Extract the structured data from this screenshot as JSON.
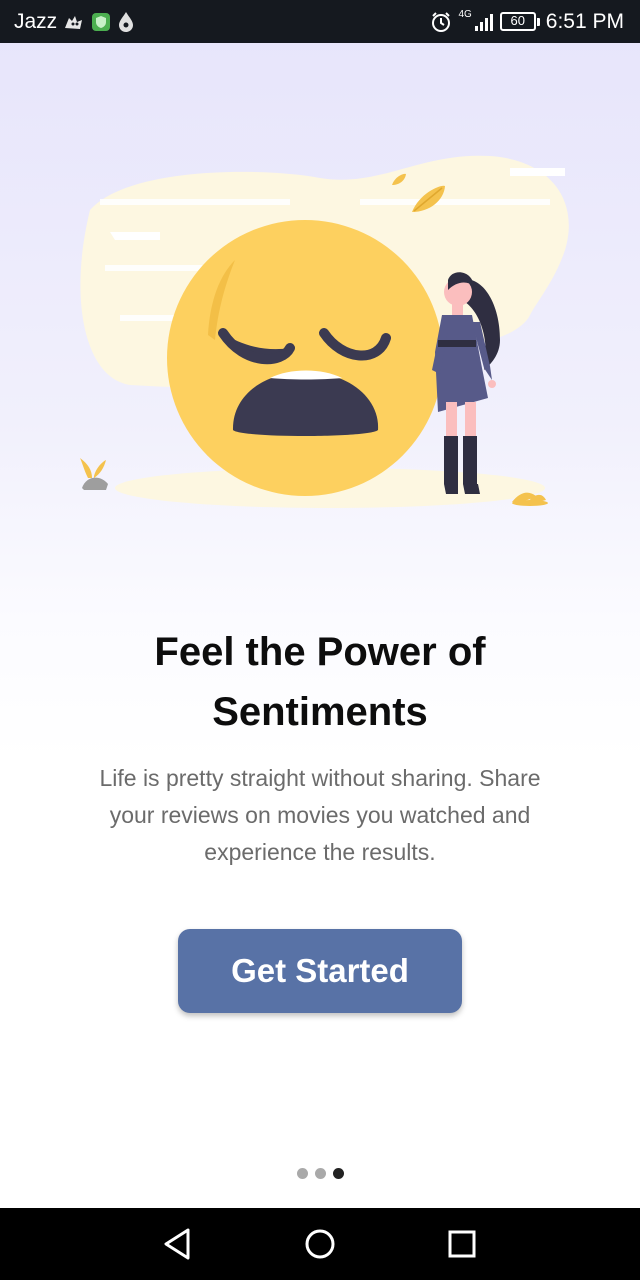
{
  "status_bar": {
    "carrier": "Jazz",
    "network": "4G",
    "battery": "60",
    "time": "6:51 PM",
    "icons": [
      "cat-icon",
      "shield-icon",
      "drop-icon",
      "alarm-icon",
      "signal-icon",
      "battery-icon"
    ]
  },
  "onboarding": {
    "illustration": "sad-emoji-with-woman",
    "headline_line1": "Feel the Power of",
    "headline_line2": "Sentiments",
    "description_line1": "Life is pretty straight without sharing. Share",
    "description_line2": "your reviews on movies you watched and",
    "description_line3": "experience the results.",
    "button_label": "Get Started",
    "page_index": 3,
    "page_count": 3
  },
  "nav_bar": {
    "icons": [
      "back-icon",
      "home-icon",
      "recents-icon"
    ]
  },
  "colors": {
    "accent": "#5872a6",
    "emoji": "#fdd05f",
    "figure": "#575a89",
    "status_bar": "#15191f"
  }
}
